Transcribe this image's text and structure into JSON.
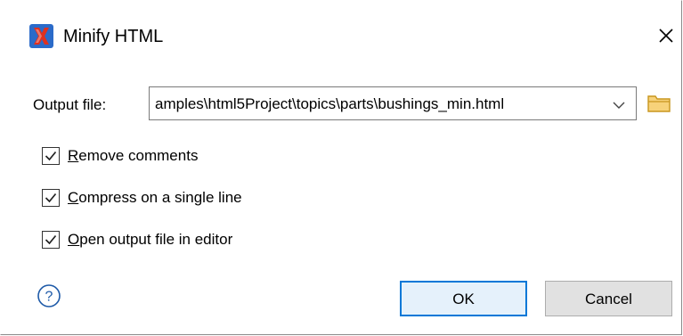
{
  "window": {
    "title": "Minify HTML",
    "app_icon": "oxygen-x-icon",
    "close_icon": "close-icon"
  },
  "output": {
    "label": "Output file:",
    "value": "amples\\html5Project\\topics\\parts\\bushings_min.html",
    "dropdown_icon": "chevron-down-icon",
    "browse_icon": "folder-icon"
  },
  "options": [
    {
      "mnemonic": "R",
      "rest": "emove comments",
      "checked": true
    },
    {
      "mnemonic": "C",
      "rest": "ompress on a single line",
      "checked": true
    },
    {
      "mnemonic": "O",
      "rest": "pen output file in editor",
      "checked": true
    }
  ],
  "buttons": {
    "help_icon": "help-icon",
    "ok_label": "OK",
    "cancel_label": "Cancel"
  },
  "colors": {
    "accent": "#0078d7",
    "app_icon_red": "#e0301e",
    "app_icon_blue": "#2b6bc9",
    "folder_yellow": "#e8b84a",
    "help_blue": "#1e5aa8"
  }
}
